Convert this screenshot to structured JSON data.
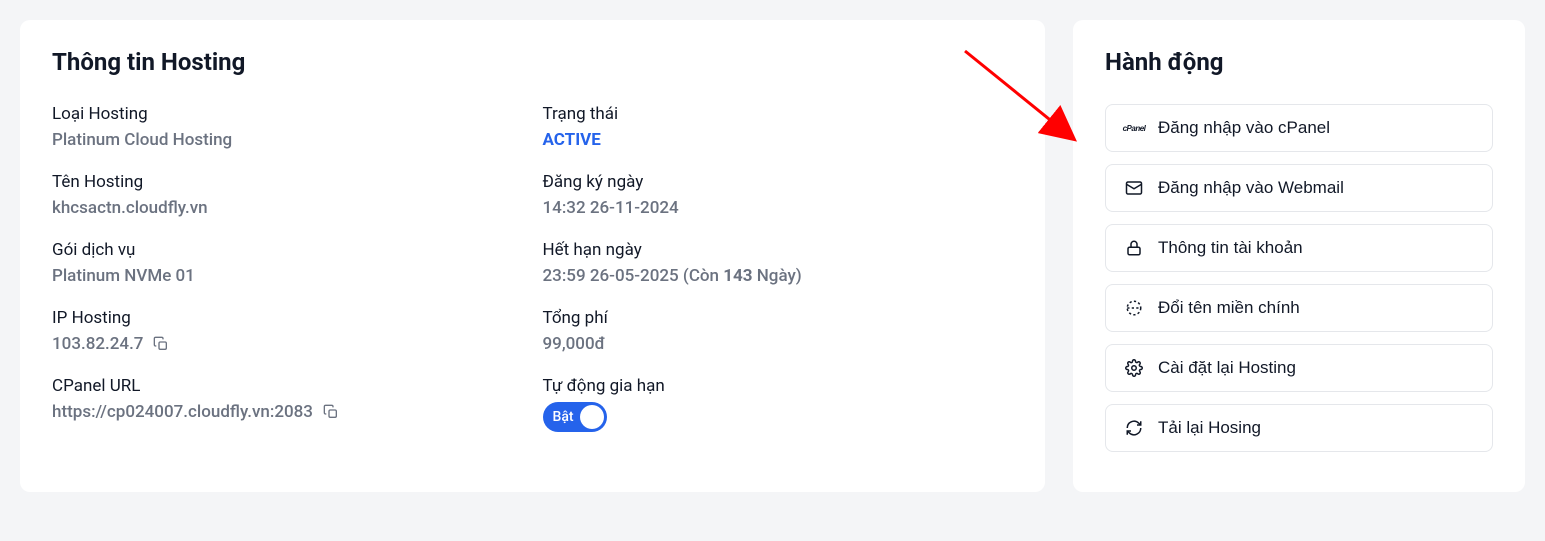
{
  "info_panel": {
    "title": "Thông tin Hosting",
    "hosting_type_label": "Loại Hosting",
    "hosting_type_value": "Platinum Cloud Hosting",
    "hosting_name_label": "Tên Hosting",
    "hosting_name_value": "khcsactn.cloudfly.vn",
    "plan_label": "Gói dịch vụ",
    "plan_value": "Platinum NVMe 01",
    "ip_label": "IP Hosting",
    "ip_value": "103.82.24.7",
    "cpanel_url_label": "CPanel URL",
    "cpanel_url_value": "https://cp024007.cloudfly.vn:2083",
    "status_label": "Trạng thái",
    "status_value": "ACTIVE",
    "regdate_label": "Đăng ký ngày",
    "regdate_value": "14:32 26-11-2024",
    "expdate_label": "Hết hạn ngày",
    "expdate_value_prefix": "23:59 26-05-2025 (Còn ",
    "expdate_value_days": "143",
    "expdate_value_suffix": " Ngày)",
    "total_label": "Tổng phí",
    "total_value": "99,000đ",
    "autorenew_label": "Tự động gia hạn",
    "autorenew_toggle_text": "Bật"
  },
  "actions_panel": {
    "title": "Hành động",
    "items": [
      "Đăng nhập vào cPanel",
      "Đăng nhập vào Webmail",
      "Thông tin tài khoản",
      "Đổi tên miền chính",
      "Cài đặt lại Hosting",
      "Tải lại Hosing"
    ]
  }
}
